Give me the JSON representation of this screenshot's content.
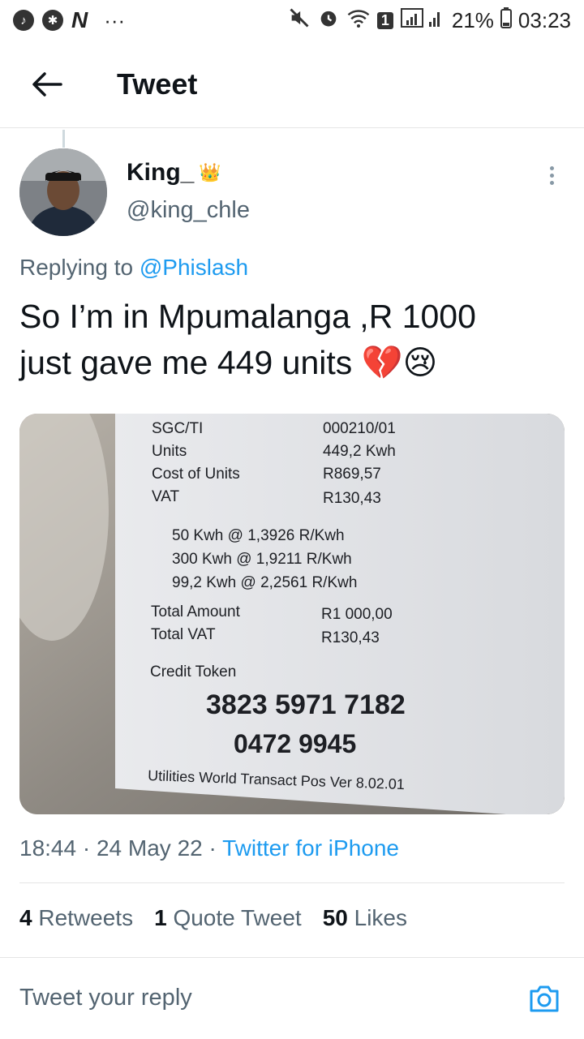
{
  "status_bar": {
    "battery": "21%",
    "time": "03:23",
    "notification_badge": "1",
    "app_icons": [
      "music-note-icon",
      "basketball-icon",
      "app-n-icon"
    ],
    "app_n_glyph": "N",
    "more_glyph": "···"
  },
  "nav": {
    "title": "Tweet"
  },
  "tweet": {
    "display_name": "King_",
    "display_emoji": "👑",
    "handle": "@king_chle",
    "reply_prefix": "Replying to",
    "reply_to": "@Phislash",
    "text_line1": "So I’m in Mpumalanga ,R 1000",
    "text_line2": "just gave me 449 units 💔😢",
    "time": "18:44",
    "date": "24 May 22",
    "source": "Twitter for iPhone",
    "separator": "·"
  },
  "receipt": {
    "rows": [
      {
        "label": "SGC/TI",
        "value": "000210/01"
      },
      {
        "label": "Units",
        "value": "449,2 Kwh"
      },
      {
        "label": "Cost of Units",
        "value": "R869,57"
      },
      {
        "label": "VAT",
        "value": "R130,43"
      }
    ],
    "tiers": [
      "50 Kwh @ 1,3926 R/Kwh",
      "300 Kwh @ 1,9211 R/Kwh",
      "99,2 Kwh @ 2,2561 R/Kwh"
    ],
    "totals": [
      {
        "label": "Total Amount",
        "value": "R1 000,00"
      },
      {
        "label": "Total VAT",
        "value": "R130,43"
      }
    ],
    "token_label": "Credit Token",
    "token_line1": "3823 5971 7182",
    "token_line2": "0472 9945",
    "footer": "Utilities World Transact Pos Ver 8.02.01"
  },
  "stats": {
    "retweets_count": "4",
    "retweets_label": "Retweets",
    "quotes_count": "1",
    "quotes_label": "Quote Tweet",
    "likes_count": "50",
    "likes_label": "Likes"
  },
  "reply": {
    "placeholder": "Tweet your reply"
  },
  "colors": {
    "link": "#1d9bf0",
    "secondary": "#536471",
    "text": "#0f1419"
  }
}
